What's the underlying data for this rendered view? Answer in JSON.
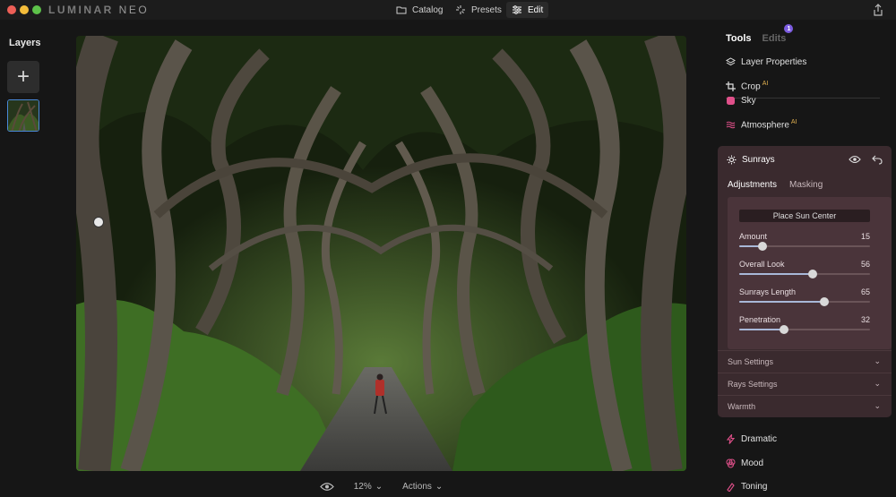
{
  "app": {
    "logo_main": "LUMINAR",
    "logo_sub": "NEO"
  },
  "nav": {
    "catalog": "Catalog",
    "presets": "Presets",
    "edit": "Edit"
  },
  "layers": {
    "title": "Layers",
    "add": "+"
  },
  "bottom": {
    "zoom": "12%",
    "actions": "Actions"
  },
  "tabs": {
    "tools": "Tools",
    "edits": "Edits",
    "edits_badge": "1"
  },
  "tools": {
    "layer_properties": "Layer Properties",
    "crop": "Crop",
    "sky": "Sky",
    "atmosphere": "Atmosphere",
    "ai_badge": "AI",
    "dramatic": "Dramatic",
    "mood": "Mood",
    "toning": "Toning"
  },
  "sunrays": {
    "title": "Sunrays",
    "tab_adjustments": "Adjustments",
    "tab_masking": "Masking",
    "place_sun_center": "Place Sun Center",
    "sliders": [
      {
        "label": "Amount",
        "value": "15",
        "percent": 18
      },
      {
        "label": "Overall Look",
        "value": "56",
        "percent": 56
      },
      {
        "label": "Sunrays Length",
        "value": "65",
        "percent": 65
      },
      {
        "label": "Penetration",
        "value": "32",
        "percent": 34
      }
    ],
    "sections": [
      "Sun Settings",
      "Rays Settings",
      "Warmth"
    ]
  },
  "colors": {
    "accent": "#7c5ce0",
    "panel": "#3a2a2e",
    "ai_badge": "#e0b050"
  }
}
